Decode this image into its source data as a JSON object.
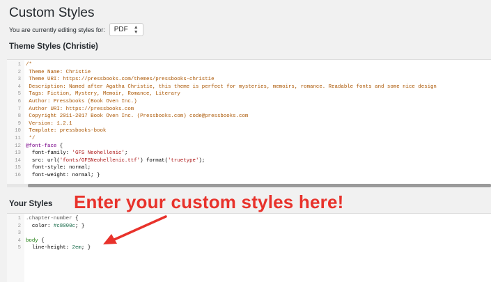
{
  "page": {
    "title": "Custom Styles",
    "editing_label": "You are currently editing styles for:",
    "format_select": {
      "value": "PDF"
    }
  },
  "theme_section": {
    "title": "Theme Styles (Christie)",
    "lines": [
      {
        "n": "1",
        "parts": [
          {
            "t": "/*",
            "c": "comment"
          }
        ]
      },
      {
        "n": "2",
        "parts": [
          {
            "t": " Theme Name: Christie",
            "c": "comment"
          }
        ]
      },
      {
        "n": "3",
        "parts": [
          {
            "t": " Theme URI: https://pressbooks.com/themes/pressbooks-christie",
            "c": "comment"
          }
        ]
      },
      {
        "n": "4",
        "parts": [
          {
            "t": " Description: Named after Agatha Christie, this theme is perfect for mysteries, memoirs, romance. Readable fonts and some nice design",
            "c": "comment"
          }
        ]
      },
      {
        "n": "5",
        "parts": [
          {
            "t": " Tags: Fiction, Mystery, Memoir, Romance, Literary",
            "c": "comment"
          }
        ]
      },
      {
        "n": "6",
        "parts": [
          {
            "t": " Author: Pressbooks (Book Oven Inc.)",
            "c": "comment"
          }
        ]
      },
      {
        "n": "7",
        "parts": [
          {
            "t": " Author URI: https://pressbooks.com",
            "c": "comment"
          }
        ]
      },
      {
        "n": "8",
        "parts": [
          {
            "t": " Copyright 2011-2017 Book Oven Inc. (Pressbooks.com) code@pressbooks.com",
            "c": "comment"
          }
        ]
      },
      {
        "n": "9",
        "parts": [
          {
            "t": " Version: 1.2.1",
            "c": "comment"
          }
        ]
      },
      {
        "n": "10",
        "parts": [
          {
            "t": " Template: pressbooks-book",
            "c": "comment"
          }
        ]
      },
      {
        "n": "11",
        "parts": [
          {
            "t": " */",
            "c": "comment"
          }
        ]
      },
      {
        "n": "12",
        "parts": [
          {
            "t": "@font-face",
            "c": "keyword"
          },
          {
            "t": " {",
            "c": "property"
          }
        ]
      },
      {
        "n": "13",
        "parts": [
          {
            "t": "  font-family: ",
            "c": "property"
          },
          {
            "t": "'GFS Neohellenic'",
            "c": "string"
          },
          {
            "t": ";",
            "c": "property"
          }
        ]
      },
      {
        "n": "14",
        "parts": [
          {
            "t": "  src: url(",
            "c": "property"
          },
          {
            "t": "'fonts/GFSNeohellenic.ttf'",
            "c": "string"
          },
          {
            "t": ") format(",
            "c": "property"
          },
          {
            "t": "'truetype'",
            "c": "string"
          },
          {
            "t": ");",
            "c": "property"
          }
        ]
      },
      {
        "n": "15",
        "parts": [
          {
            "t": "  font-style: normal;",
            "c": "property"
          }
        ]
      },
      {
        "n": "16",
        "parts": [
          {
            "t": "  font-weight: normal; }",
            "c": "property"
          }
        ]
      }
    ]
  },
  "your_section": {
    "title": "Your Styles",
    "lines": [
      {
        "n": "1",
        "parts": [
          {
            "t": ".chapter-number",
            "c": "qualifier"
          },
          {
            "t": " {",
            "c": "property"
          }
        ]
      },
      {
        "n": "2",
        "parts": [
          {
            "t": "  color: ",
            "c": "property"
          },
          {
            "t": "#c8000c",
            "c": "number"
          },
          {
            "t": "; }",
            "c": "property"
          }
        ]
      },
      {
        "n": "3",
        "parts": []
      },
      {
        "n": "4",
        "parts": [
          {
            "t": "body",
            "c": "tag"
          },
          {
            "t": " {",
            "c": "property"
          }
        ]
      },
      {
        "n": "5",
        "parts": [
          {
            "t": "  line-height: ",
            "c": "property"
          },
          {
            "t": "2em",
            "c": "number"
          },
          {
            "t": "; }",
            "c": "property"
          }
        ]
      }
    ]
  },
  "annotation": {
    "text": "Enter your custom styles here!",
    "color": "#e8322b"
  }
}
